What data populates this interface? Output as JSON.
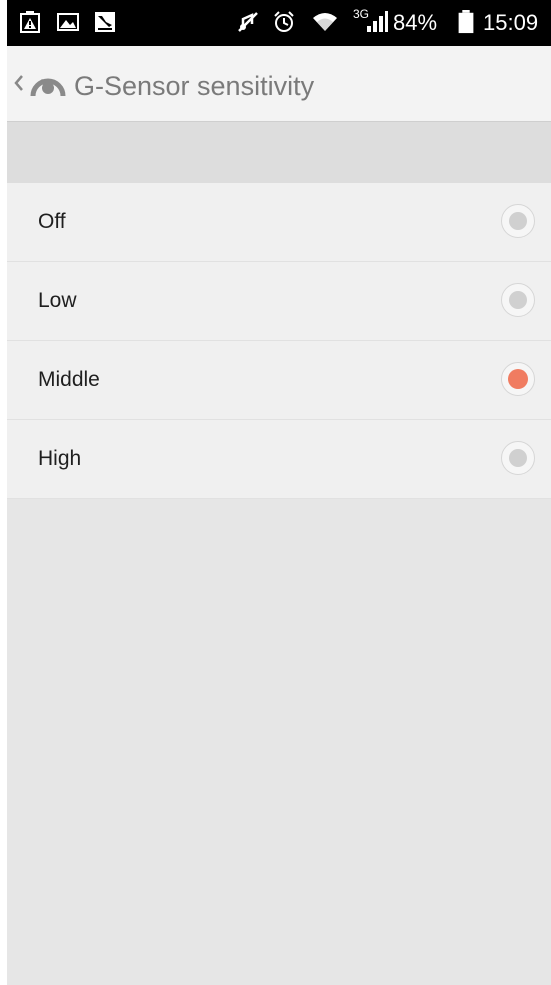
{
  "status_bar": {
    "battery": "84%",
    "time": "15:09",
    "network": "3G",
    "icons": [
      "screenshot-alert-icon",
      "gallery-icon",
      "bird-app-icon",
      "mute-icon",
      "alarm-icon",
      "wifi-icon",
      "signal-icon",
      "battery-icon"
    ]
  },
  "app_bar": {
    "title": "G-Sensor sensitivity",
    "icons": [
      "back-chevron-icon",
      "gauge-app-icon"
    ]
  },
  "options": [
    {
      "label": "Off",
      "selected": false
    },
    {
      "label": "Low",
      "selected": false
    },
    {
      "label": "Middle",
      "selected": true
    },
    {
      "label": "High",
      "selected": false
    }
  ],
  "colors": {
    "accent": "#f07c61",
    "background": "#e6e6e6",
    "row": "#f0f0f0",
    "app_bar": "#f3f3f3"
  }
}
